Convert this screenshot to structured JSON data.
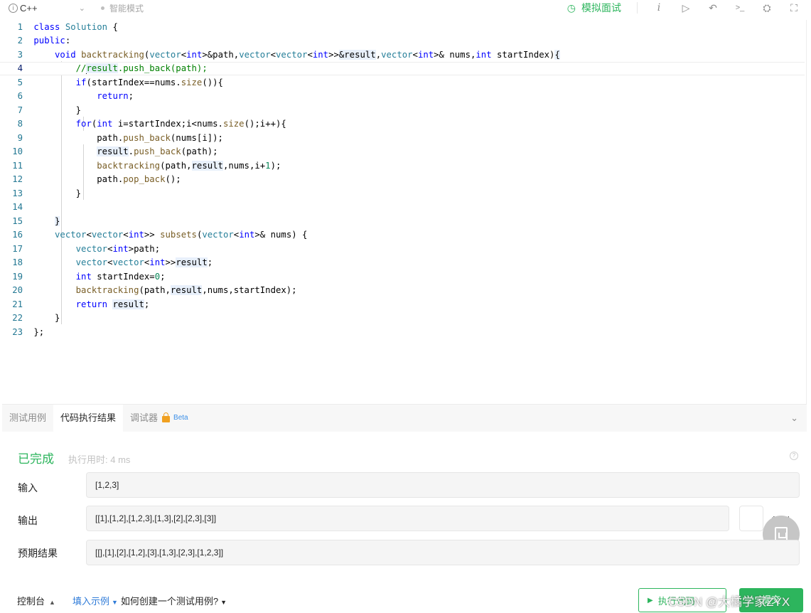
{
  "toolbar": {
    "language": "C++",
    "smart_mode": "智能模式",
    "mock_interview": "模拟面试",
    "icons": [
      "info-italic-icon",
      "run-triangle-icon",
      "reset-icon",
      "terminal-icon",
      "settings-icon",
      "fullscreen-icon"
    ]
  },
  "editor": {
    "line_numbers": [
      "1",
      "2",
      "3",
      "4",
      "5",
      "6",
      "7",
      "8",
      "9",
      "10",
      "11",
      "12",
      "13",
      "14",
      "15",
      "16",
      "17",
      "18",
      "19",
      "20",
      "21",
      "22",
      "23"
    ]
  },
  "panel": {
    "tabs": [
      "测试用例",
      "代码执行结果",
      "调试器"
    ],
    "beta": "Beta",
    "status": "已完成",
    "exec_time": "执行用时: 4 ms",
    "input_label": "输入",
    "input_value": "[1,2,3]",
    "output_label": "输出",
    "output_value": "[[1],[1,2],[1,2,3],[1,3],[2],[2,3],[3]]",
    "expected_label": "预期结果",
    "expected_value": "[[],[1],[2],[1,2],[3],[1,3],[2,3],[1,2,3]]",
    "diff_label": "差别"
  },
  "footer": {
    "console": "控制台",
    "fill_example": "填入示例",
    "how_to": "如何创建一个测试用例?",
    "run": "执行代码",
    "submit": "提交"
  },
  "watermark": "CSDN @大橘学家ZYX",
  "colors": {
    "accent_green": "#2db55d",
    "link_blue": "#2f7bd8",
    "keyword_blue": "#0000ff",
    "type_teal": "#267f99"
  }
}
